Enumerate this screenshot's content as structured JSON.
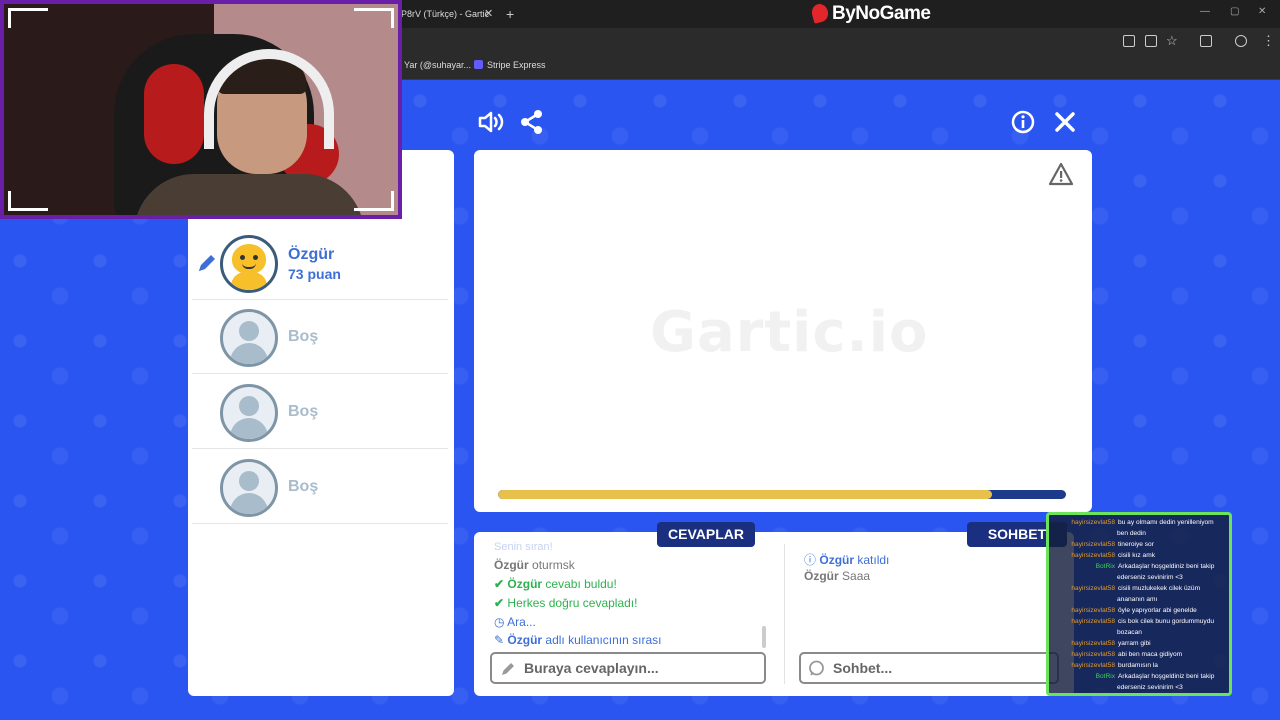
{
  "browser": {
    "tab_title": "P8rV (Türkçe) - Gartic",
    "tab_close": "✕",
    "new_tab": "+",
    "brand_logo": "ByNoGame",
    "bookmarks": [
      "Yar (@suhayar...",
      "Stripe Express"
    ]
  },
  "game": {
    "players": [
      {
        "name": "Özgür",
        "score": "73 puan",
        "avatar": "yellow-character",
        "drawing": true
      },
      {
        "name": "Boş",
        "score": "",
        "avatar": "empty"
      },
      {
        "name": "Boş",
        "score": "",
        "avatar": "empty"
      },
      {
        "name": "Boş",
        "score": "",
        "avatar": "empty"
      }
    ],
    "canvas_watermark": "Gartic.io",
    "round_progress_percent": 87,
    "answers_label": "CEVAPLAR",
    "chat_label": "SOHBET",
    "answers": {
      "line0": "Senin sıran!",
      "line1_user": "Özgür",
      "line1_text": "oturmsk",
      "line2_user": "Özgür",
      "line2_text": "cevabı buldu!",
      "line3_text": "Herkes doğru cevapladı!",
      "line4_text": "Ara...",
      "line5_user": "Özgür",
      "line5_text": "adlı kullanıcının sırası"
    },
    "chat": {
      "line1_user": "Özgür",
      "line1_text": "katıldı",
      "line2_user": "Özgür",
      "line2_text": "Saaa"
    },
    "answer_placeholder": "Buraya cevaplayın...",
    "chat_placeholder": "Sohbet..."
  },
  "stream_chat": [
    {
      "user": "hayirsizevlat58",
      "text": "bu ay olmamı dedin yenilleniyom ben dedin",
      "color": "orange"
    },
    {
      "user": "hayirsizevlat58",
      "text": "tineroiye sor",
      "color": "orange"
    },
    {
      "user": "hayirsizevlat58",
      "text": "cisili kız amk",
      "color": "orange"
    },
    {
      "user": "BotRix",
      "text": "Arkadaşlar hoşgeldiniz beni takip ederseniz sevinirim <3",
      "color": "green"
    },
    {
      "user": "hayirsizevlat58",
      "text": "cisili muzlukekek cilek üzüm anananın amı",
      "color": "orange"
    },
    {
      "user": "hayirsizevlat58",
      "text": "öyle yapıyorlar abi genelde",
      "color": "orange"
    },
    {
      "user": "hayirsizevlat58",
      "text": "cis bok cilek bunu gordummuydu bozacan",
      "color": "orange"
    },
    {
      "user": "hayirsizevlat58",
      "text": "yarram gibi",
      "color": "orange"
    },
    {
      "user": "hayirsizevlat58",
      "text": "abi ben maca gidiyom",
      "color": "orange"
    },
    {
      "user": "hayirsizevlat58",
      "text": "burdamısın la",
      "color": "orange"
    },
    {
      "user": "BotRix",
      "text": "Arkadaşlar hoşgeldiniz beni takip ederseniz sevinirim <3",
      "color": "green"
    }
  ],
  "colors": {
    "background": "#2a55f0",
    "accent_blue": "#3d6fd6",
    "success_green": "#2fb14f",
    "tag_navy": "#1b2f80",
    "progress_yellow": "#e8c14d"
  },
  "icons": [
    "sound-icon",
    "share-icon",
    "info-icon",
    "close-icon",
    "warning-icon",
    "pencil-icon",
    "check-icon",
    "clock-icon",
    "search-icon"
  ]
}
